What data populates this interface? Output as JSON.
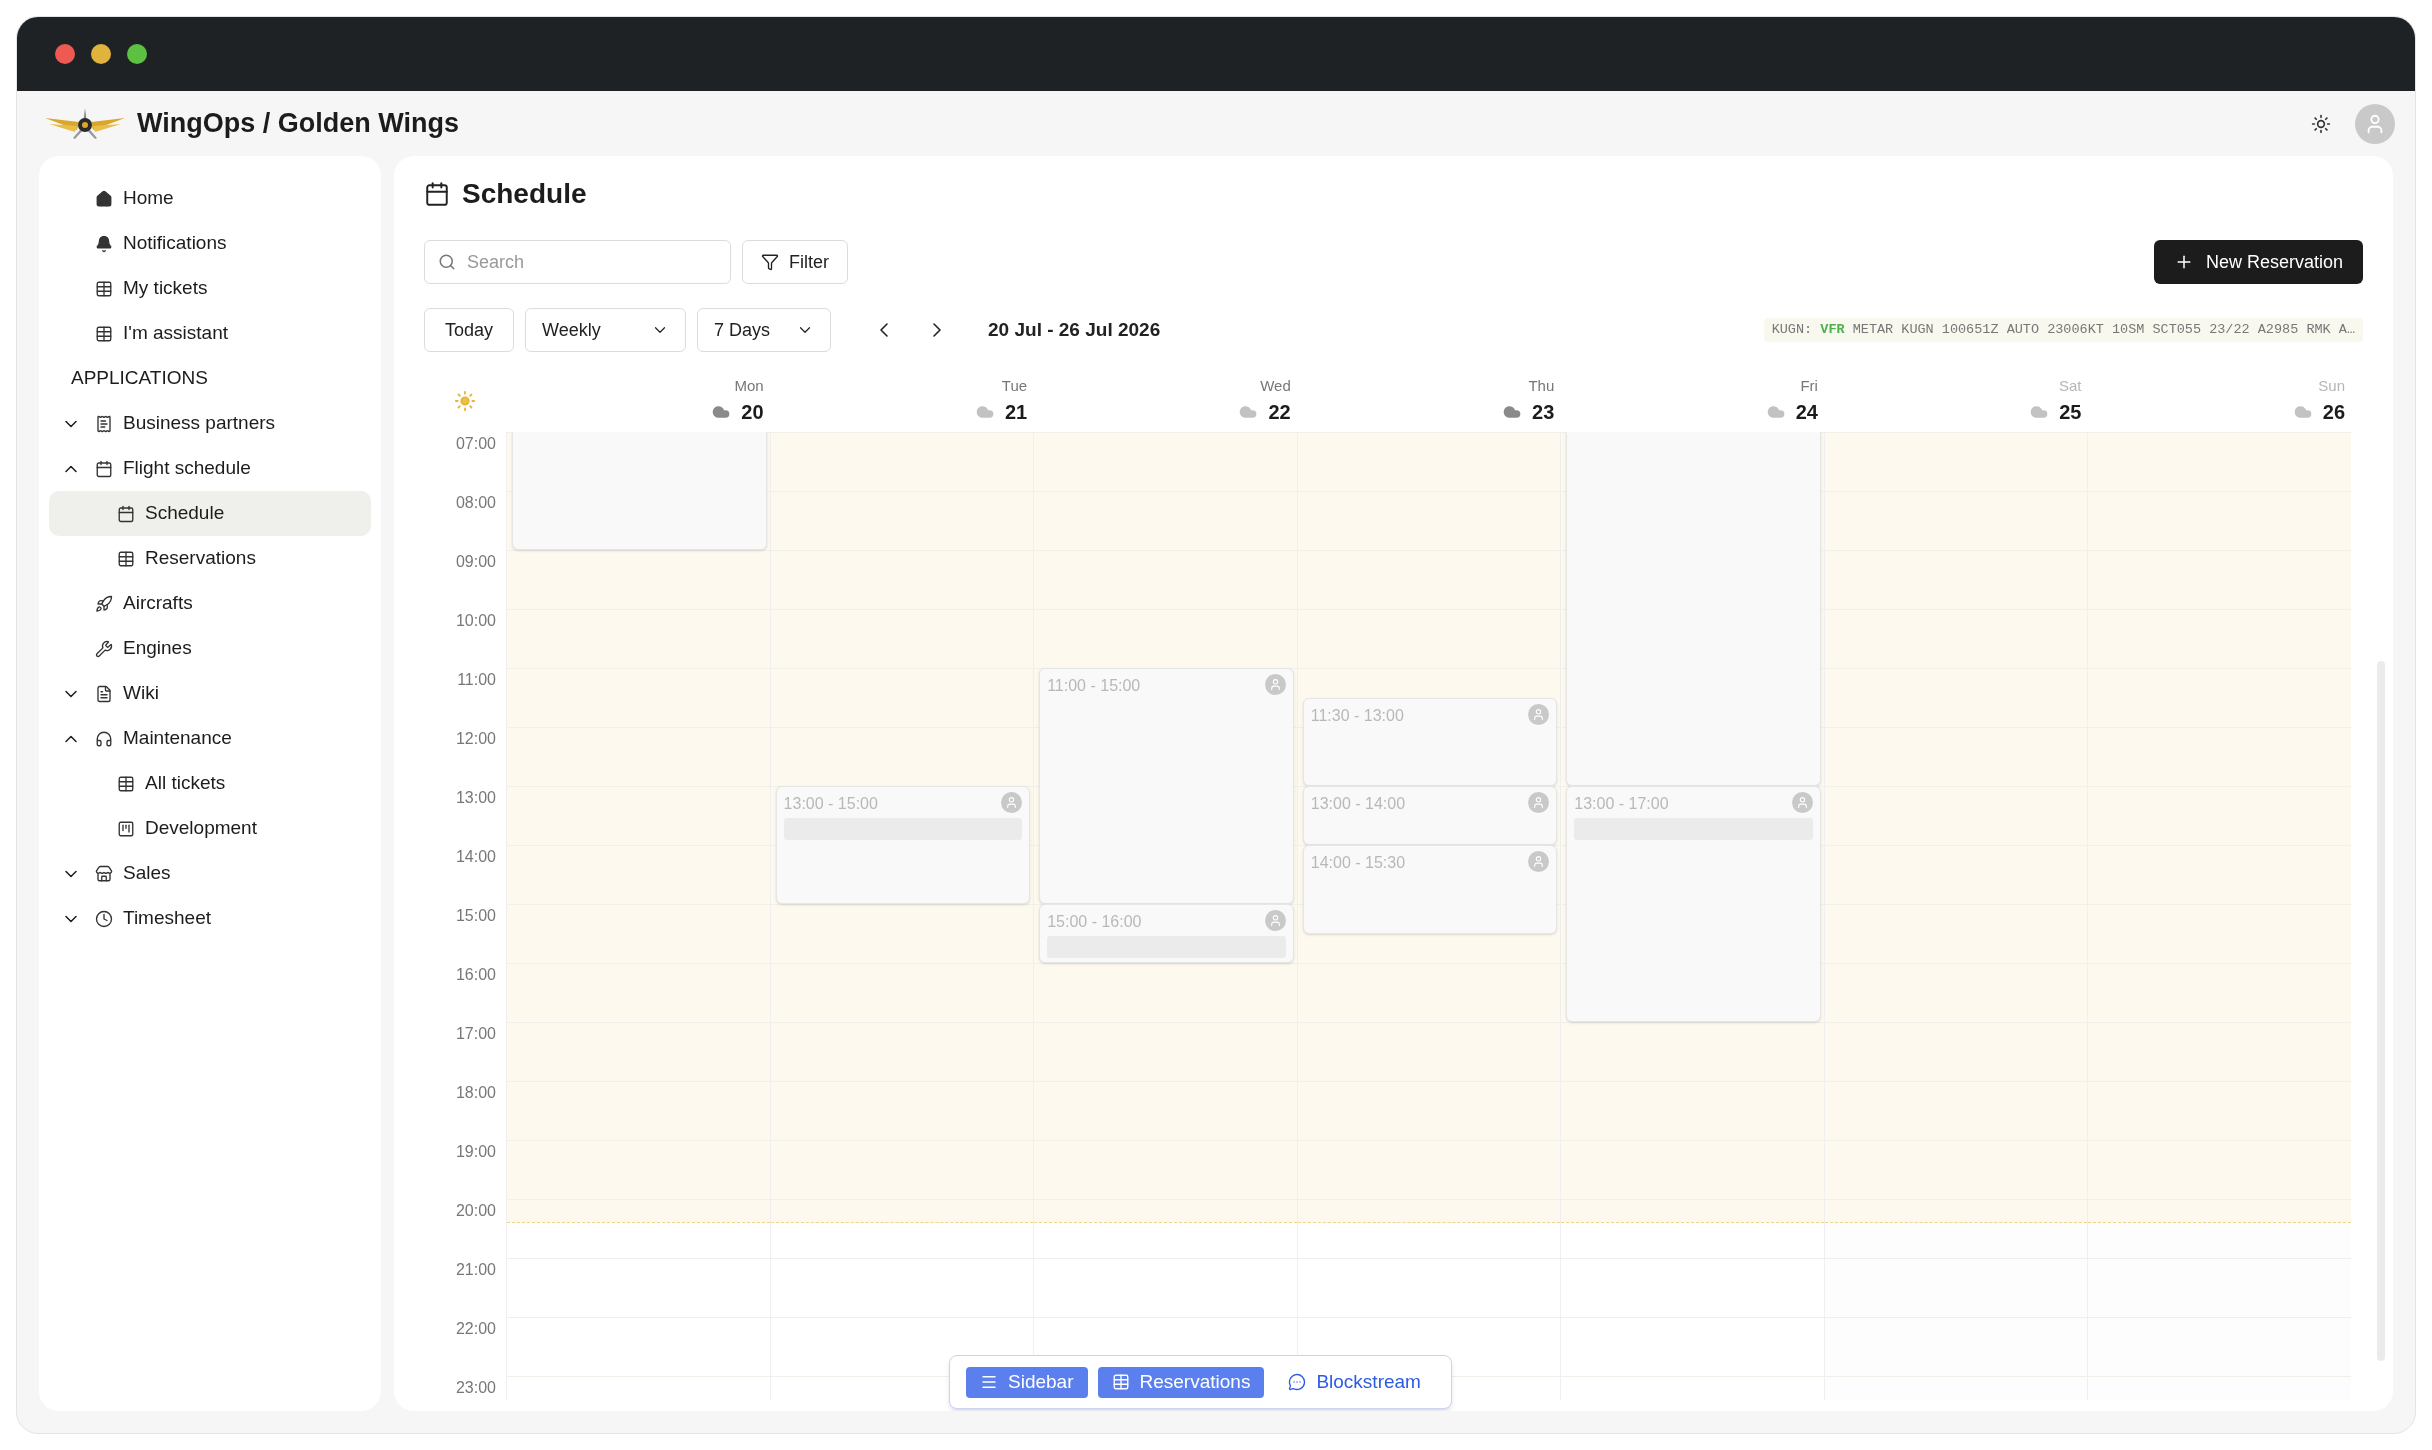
{
  "window": {
    "title": "WingOps / Golden Wings"
  },
  "sidebar": {
    "top_items": [
      {
        "label": "Home",
        "selected": false
      },
      {
        "label": "Notifications",
        "selected": false
      },
      {
        "label": "My tickets",
        "selected": false
      },
      {
        "label": "I'm assistant",
        "selected": false
      }
    ],
    "section_title": "APPLICATIONS",
    "app_items": [
      {
        "label": "Business partners",
        "selected": false,
        "expanded": false
      },
      {
        "label": "Flight schedule",
        "selected": false,
        "expanded": true,
        "children": [
          {
            "label": "Schedule",
            "selected": true
          },
          {
            "label": "Reservations",
            "selected": false
          }
        ]
      },
      {
        "label": "Aircrafts",
        "selected": false
      },
      {
        "label": "Engines",
        "selected": false
      },
      {
        "label": "Wiki",
        "selected": false,
        "expanded": false
      },
      {
        "label": "Maintenance",
        "selected": false,
        "expanded": true,
        "children": [
          {
            "label": "All tickets",
            "selected": false
          },
          {
            "label": "Development",
            "selected": false
          }
        ]
      },
      {
        "label": "Sales",
        "selected": false,
        "expanded": false
      },
      {
        "label": "Timesheet",
        "selected": false,
        "expanded": false
      }
    ]
  },
  "page": {
    "title": "Schedule"
  },
  "toolbar": {
    "search": {
      "placeholder": "Search"
    },
    "filter": "Filter",
    "new_button": "New Reservation",
    "today": "Today",
    "view": "Weekly",
    "range": "7 Days",
    "date_range": "20 Jul - 26 Jul 2026",
    "metar": {
      "station": "KUGN:",
      "category": "VFR",
      "report": "METAR KUGN 100651Z AUTO 23006KT 10SM SCT055 23/22 A2985 RMK A…"
    }
  },
  "calendar": {
    "hours": [
      "07:00",
      "08:00",
      "09:00",
      "10:00",
      "11:00",
      "12:00",
      "13:00",
      "14:00",
      "15:00",
      "16:00",
      "17:00",
      "18:00",
      "19:00",
      "20:00",
      "21:00",
      "22:00",
      "23:00"
    ],
    "days": [
      {
        "weekday": "Mon",
        "date": "20",
        "weekend": false,
        "dark_cloud": true,
        "events": [
          {
            "kind": "blank"
          }
        ]
      },
      {
        "weekday": "Tue",
        "date": "21",
        "weekend": false,
        "dark_cloud": false,
        "events": [
          {
            "kind": "booking",
            "time": "13:00 - 15:00",
            "blurred_line": true
          }
        ]
      },
      {
        "weekday": "Wed",
        "date": "22",
        "weekend": false,
        "dark_cloud": false,
        "events": [
          {
            "kind": "booking",
            "time": "11:00 - 15:00",
            "blurred_line": false
          },
          {
            "kind": "booking",
            "time": "15:00 - 16:00",
            "blurred_line": true
          }
        ]
      },
      {
        "weekday": "Thu",
        "date": "23",
        "weekend": false,
        "dark_cloud": true,
        "events": [
          {
            "kind": "booking",
            "time": "11:30 - 13:00",
            "blurred_line": false
          },
          {
            "kind": "booking",
            "time": "13:00 - 14:00",
            "blurred_line": false
          },
          {
            "kind": "booking",
            "time": "14:00 - 15:30",
            "blurred_line": false
          }
        ]
      },
      {
        "weekday": "Fri",
        "date": "24",
        "weekend": false,
        "dark_cloud": false,
        "events": [
          {
            "kind": "blank"
          },
          {
            "kind": "booking",
            "time": "13:00 - 17:00",
            "blurred_line": true
          }
        ]
      },
      {
        "weekday": "Sat",
        "date": "25",
        "weekend": true,
        "dark_cloud": false
      },
      {
        "weekday": "Sun",
        "date": "26",
        "weekend": true,
        "dark_cloud": false
      }
    ]
  },
  "bottom_bar": [
    {
      "label": "Sidebar",
      "active": true
    },
    {
      "label": "Reservations",
      "active": true
    },
    {
      "label": "Blockstream",
      "active": false
    }
  ]
}
